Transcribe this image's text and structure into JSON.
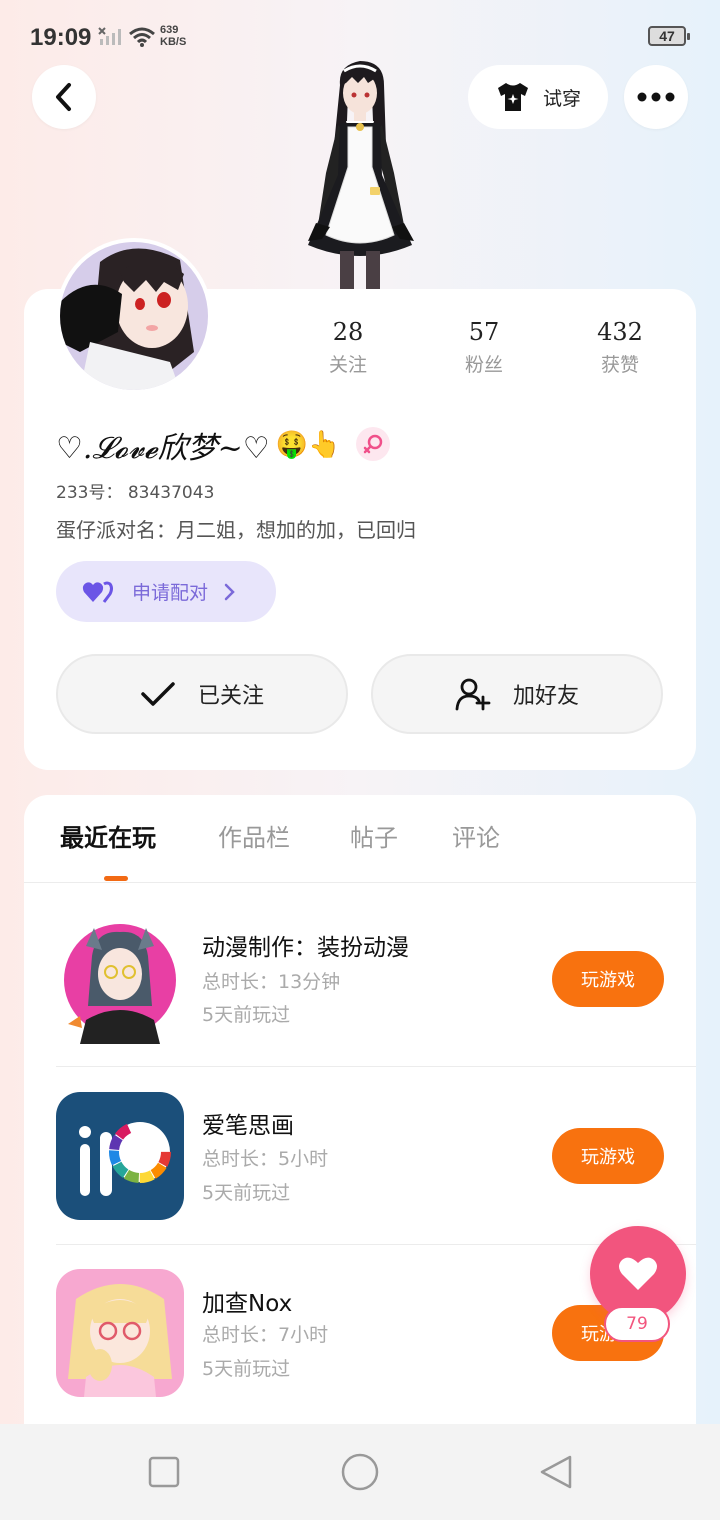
{
  "status_bar": {
    "time": "19:09",
    "net_speed_value": "639",
    "net_speed_unit": "KB/S",
    "battery": "47"
  },
  "header": {
    "tryon_label": "试穿"
  },
  "profile": {
    "nickname": "♡.𝓛𝓸𝓿𝓮欣梦~♡",
    "emoji": "🤑👆",
    "stats": [
      {
        "value": "28",
        "label": "关注"
      },
      {
        "value": "57",
        "label": "粉丝"
      },
      {
        "value": "432",
        "label": "获赞"
      }
    ],
    "uid": "233号： 83437043",
    "party_name": "蛋仔派对名：月二姐，想加的加，已回归",
    "pair_label": "申请配对",
    "follow_label": "已关注",
    "add_friend_label": "加好友"
  },
  "tabs": [
    {
      "label": "最近在玩"
    },
    {
      "label": "作品栏"
    },
    {
      "label": "帖子"
    },
    {
      "label": "评论"
    }
  ],
  "games": [
    {
      "title": "动漫制作：装扮动漫",
      "duration": "总时长：13分钟",
      "last_played": "5天前玩过",
      "play_label": "玩游戏"
    },
    {
      "title": "爱笔思画",
      "duration": "总时长：5小时",
      "last_played": "5天前玩过",
      "play_label": "玩游戏"
    },
    {
      "title": "加查Nox",
      "duration": "总时长：7小时",
      "last_played": "5天前玩过",
      "play_label": "玩游戏"
    }
  ],
  "like": {
    "count": "79"
  },
  "colors": {
    "accent_orange": "#f8720f",
    "like_pink": "#f2557e",
    "pair_purple": "#7b6ad9"
  }
}
